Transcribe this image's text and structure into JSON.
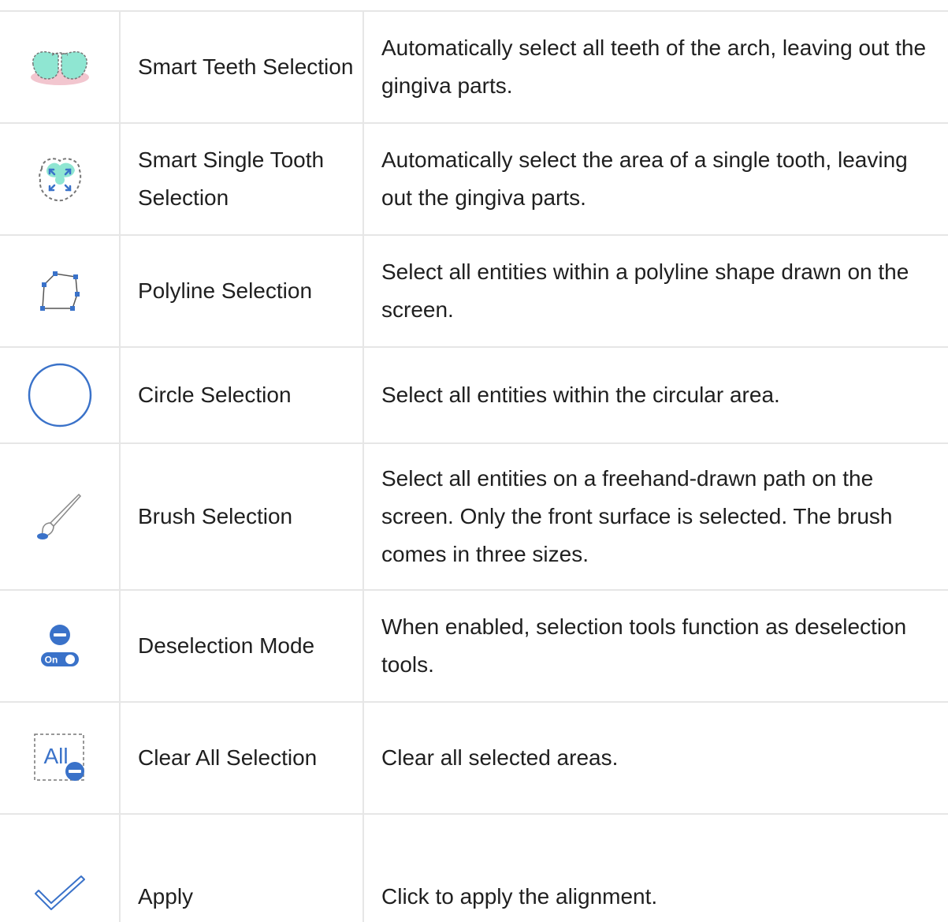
{
  "tools": [
    {
      "icon": "smart-teeth-selection-icon",
      "name": "Smart Teeth Selection",
      "description": "Automatically select all teeth of the arch, leaving out the gingiva parts."
    },
    {
      "icon": "smart-single-tooth-selection-icon",
      "name": "Smart Single Tooth Selection",
      "description": "Automatically select the area of a single tooth, leaving out the gingiva parts."
    },
    {
      "icon": "polyline-selection-icon",
      "name": "Polyline Selection",
      "description": "Select all entities within a polyline shape drawn on the screen."
    },
    {
      "icon": "circle-selection-icon",
      "name": "Circle Selection",
      "description": "Select all entities within the circular area."
    },
    {
      "icon": "brush-selection-icon",
      "name": "Brush Selection",
      "description": "Select all entities on a freehand-drawn path on the screen. Only the front surface is selected. The brush comes in three sizes."
    },
    {
      "icon": "deselection-mode-toggle-icon",
      "toggle_label": "On",
      "name": "Deselection Mode",
      "description": "When enabled, selection tools function as deselection tools."
    },
    {
      "icon": "clear-all-selection-icon",
      "icon_text": "All",
      "name": "Clear All Selection",
      "description": "Clear all selected areas."
    },
    {
      "icon": "apply-checkmark-icon",
      "name": "Apply",
      "description": "Click to apply the alignment."
    }
  ],
  "colors": {
    "accent_blue": "#3a72c9",
    "teeth_mint": "#8fe6d2",
    "gum_pink": "#f2c6cf",
    "border": "#e6e6e6"
  }
}
